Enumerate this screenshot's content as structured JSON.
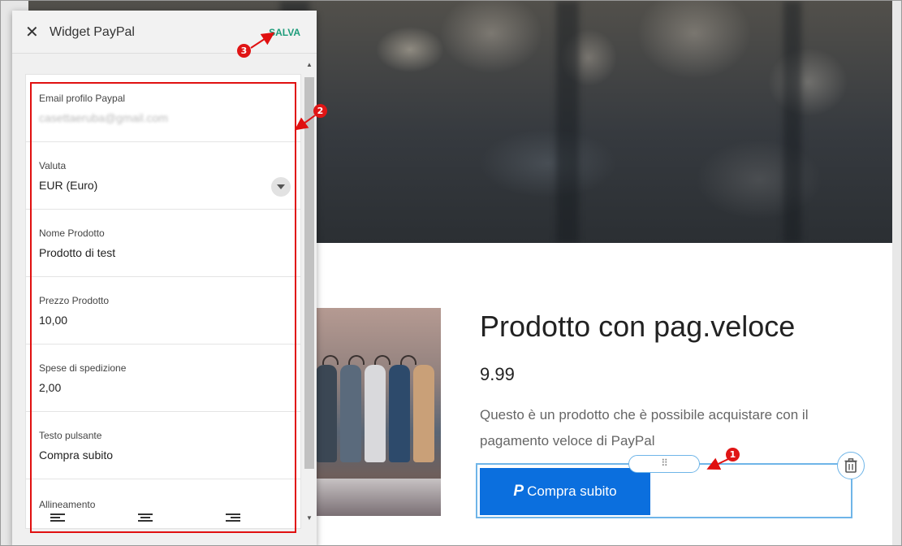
{
  "panel": {
    "title": "Widget PayPal",
    "save_label": "SALVA",
    "fields": [
      {
        "label": "Email profilo Paypal",
        "value": "casettaeruba@gmail.com"
      },
      {
        "label": "Valuta",
        "value": "EUR (Euro)"
      },
      {
        "label": "Nome Prodotto",
        "value": "Prodotto di test"
      },
      {
        "label": "Prezzo Prodotto",
        "value": "10,00"
      },
      {
        "label": "Spese di spedizione",
        "value": "2,00"
      },
      {
        "label": "Testo pulsante",
        "value": "Compra subito"
      }
    ],
    "alignment_label": "Allineamento"
  },
  "product": {
    "title": "Prodotto con pag.veloce",
    "price": "9.99",
    "description": "Questo è un prodotto che è possibile acquistare con il pagamento veloce di PayPal",
    "button_label": "Compra subito",
    "button_logo": "P"
  },
  "annotations": [
    "1",
    "2",
    "3"
  ],
  "colors": {
    "accent_button": "#0b6fde",
    "save": "#1d9c7a",
    "annotation": "#e01010",
    "selection": "#6fb5e8"
  },
  "icons": [
    "close-icon",
    "chevron-down-icon",
    "drag-handle-icon",
    "trash-icon",
    "paypal-icon",
    "align-left-icon",
    "align-center-icon",
    "align-right-icon"
  ]
}
